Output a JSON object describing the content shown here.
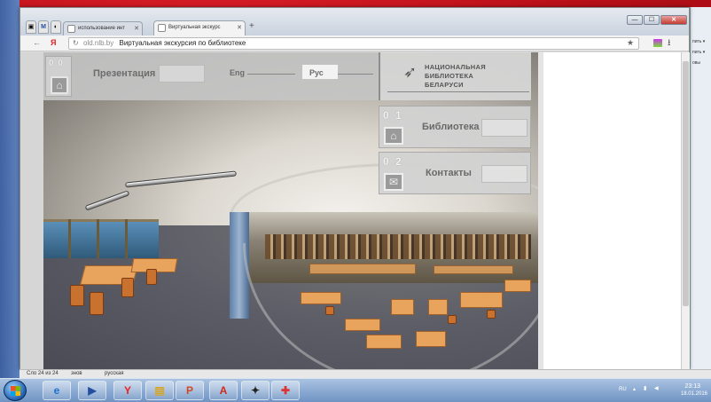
{
  "browser": {
    "tabs": [
      {
        "label": "",
        "icon": "pin-icon"
      },
      {
        "label": "M",
        "icon": "mail-icon"
      },
      {
        "label": "",
        "icon": "chrome-icon"
      },
      {
        "label": "использование инт",
        "icon": "info-icon"
      },
      {
        "label": "Виртуальная экскурс",
        "icon": "page-icon",
        "active": true
      }
    ],
    "new_tab": "+",
    "window_controls": {
      "minimize": "—",
      "maximize": "☐",
      "close": "✕"
    },
    "back": "←",
    "yandex": "Я",
    "reload": "↻",
    "url_domain": "old.nlb.by",
    "url_title": "Виртуальная экскурсия по библиотеке",
    "star": "★",
    "download": "⭳"
  },
  "overlay": {
    "tile_zero": "0 0",
    "presentation": "Презентация",
    "lang_eng": "Eng",
    "lang_rus": "Рус",
    "logo": {
      "line1": "НАЦИОНАЛЬНАЯ",
      "line2": "БИБЛИОТЕКА",
      "line3": "БЕЛАРУСИ"
    },
    "tiles": [
      {
        "num": "0 1",
        "label": "Библиотека"
      },
      {
        "num": "0 2",
        "label": "Контакты"
      }
    ]
  },
  "background_window": {
    "rows": [
      "пить ▾",
      "пить ▾",
      "овы"
    ]
  },
  "statusbar": {
    "left": "Сло 24 из 24",
    "mid1": "знов",
    "mid2": "русская"
  },
  "taskbar": {
    "items": [
      {
        "icon": "internet-explorer-icon",
        "glyph": "e",
        "color": "#1b6fd1"
      },
      {
        "icon": "media-player-icon",
        "glyph": "▶",
        "color": "#244f9e"
      },
      {
        "icon": "yandex-browser-icon",
        "glyph": "Y",
        "color": "#e22"
      },
      {
        "icon": "folder-icon",
        "glyph": "▤",
        "color": "#d9a520"
      },
      {
        "icon": "presentation-icon",
        "glyph": "P",
        "color": "#d24726"
      },
      {
        "icon": "pdf-icon",
        "glyph": "A",
        "color": "#d12a1c"
      },
      {
        "icon": "game-icon",
        "glyph": "✦",
        "color": "#222"
      },
      {
        "icon": "puzzle-icon",
        "glyph": "✚",
        "color": "#d33"
      }
    ],
    "tray_lang": "RU",
    "time": "23:13",
    "date": "18.01.2016"
  },
  "colors": {
    "desktop": "#c0111b",
    "taskbar": "#6f94c4",
    "accent_logo": "#555555"
  }
}
